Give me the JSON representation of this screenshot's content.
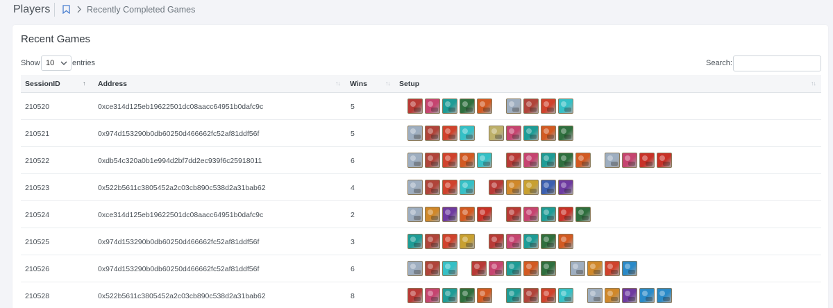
{
  "header": {
    "title": "Players",
    "breadcrumb": "Recently Completed Games"
  },
  "card": {
    "title": "Recent Games"
  },
  "controls": {
    "show_label": "Show",
    "entries_value": "10",
    "entries_label": "entries",
    "search_label": "Search:",
    "search_value": ""
  },
  "columns": [
    "SessionID",
    "Address",
    "Wins",
    "Setup"
  ],
  "hero_colors": {
    "A": "#b83a36",
    "B": "#c64470",
    "C": "#1e9c96",
    "D": "#2f6f3e",
    "E": "#d25a22",
    "F": "#9eaec0",
    "G": "#b0443a",
    "H": "#d0422c",
    "I": "#35c0c6",
    "J": "#bdb06a",
    "K": "#6e3aa0",
    "L": "#d0882a",
    "M": "#c83228",
    "N": "#3b5fb0",
    "O": "#c8a030",
    "P": "#2a8ac8"
  },
  "rows": [
    {
      "session": "210520",
      "address": "0xce314d125eb19622501dc08aacc64951b0dafc9c",
      "wins": "5",
      "setup": [
        [
          "A",
          "B",
          "C",
          "D",
          "E"
        ],
        [
          "F",
          "G",
          "H",
          "I"
        ]
      ]
    },
    {
      "session": "210521",
      "address": "0x974d153290b0db60250d466662fc52af81ddf56f",
      "wins": "5",
      "setup": [
        [
          "F",
          "G",
          "H",
          "I"
        ],
        [
          "J",
          "B",
          "C",
          "E",
          "D"
        ]
      ]
    },
    {
      "session": "210522",
      "address": "0xdb54c320a0b1e994d2bf7dd2ec939f6c25918011",
      "wins": "6",
      "setup": [
        [
          "F",
          "G",
          "H",
          "E",
          "I"
        ],
        [
          "A",
          "B",
          "C",
          "D",
          "E"
        ],
        [
          "F",
          "B",
          "M",
          "M"
        ]
      ]
    },
    {
      "session": "210523",
      "address": "0x522b5611c3805452a2c03cb890c538d2a31bab62",
      "wins": "4",
      "setup": [
        [
          "F",
          "G",
          "H",
          "I"
        ],
        [
          "A",
          "L",
          "O",
          "N",
          "K"
        ]
      ]
    },
    {
      "session": "210524",
      "address": "0xce314d125eb19622501dc08aacc64951b0dafc9c",
      "wins": "2",
      "setup": [
        [
          "F",
          "L",
          "K",
          "E",
          "M"
        ],
        [
          "A",
          "B",
          "C",
          "M",
          "D"
        ]
      ]
    },
    {
      "session": "210525",
      "address": "0x974d153290b0db60250d466662fc52af81ddf56f",
      "wins": "3",
      "setup": [
        [
          "C",
          "G",
          "H",
          "O"
        ],
        [
          "A",
          "B",
          "C",
          "D",
          "E"
        ]
      ]
    },
    {
      "session": "210526",
      "address": "0x974d153290b0db60250d466662fc52af81ddf56f",
      "wins": "6",
      "setup": [
        [
          "F",
          "G",
          "I"
        ],
        [
          "A",
          "B",
          "C",
          "E",
          "D"
        ],
        [
          "F",
          "L",
          "H",
          "P"
        ]
      ]
    },
    {
      "session": "210528",
      "address": "0x522b5611c3805452a2c03cb890c538d2a31bab62",
      "wins": "8",
      "setup": [
        [
          "A",
          "B",
          "C",
          "D",
          "E"
        ],
        [
          "C",
          "G",
          "H",
          "I"
        ],
        [
          "F",
          "L",
          "K",
          "P",
          "P"
        ]
      ]
    }
  ]
}
